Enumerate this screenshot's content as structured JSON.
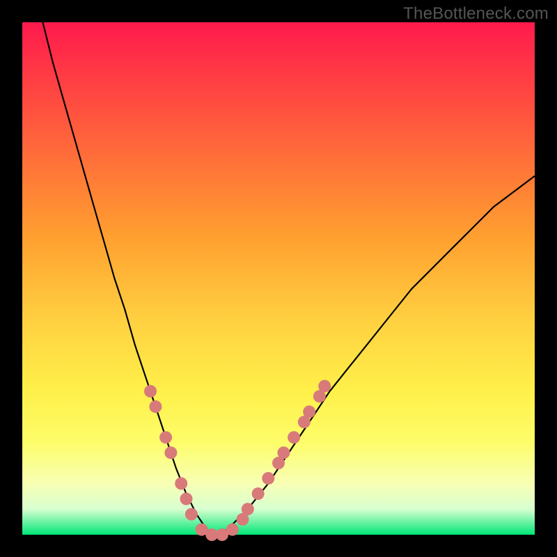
{
  "watermark": {
    "text": "TheBottleneck.com"
  },
  "chart_data": {
    "type": "line",
    "title": "",
    "xlabel": "",
    "ylabel": "",
    "xlim": [
      0,
      100
    ],
    "ylim": [
      0,
      100
    ],
    "grid": false,
    "legend": false,
    "background_gradient": {
      "direction": "vertical",
      "stops": [
        {
          "pos": 0.0,
          "color": "#ff1a4d"
        },
        {
          "pos": 0.1,
          "color": "#ff3a44"
        },
        {
          "pos": 0.25,
          "color": "#ff6a3a"
        },
        {
          "pos": 0.42,
          "color": "#ffa030"
        },
        {
          "pos": 0.58,
          "color": "#ffd040"
        },
        {
          "pos": 0.72,
          "color": "#fff04a"
        },
        {
          "pos": 0.82,
          "color": "#fdfd6a"
        },
        {
          "pos": 0.9,
          "color": "#f8ffb4"
        },
        {
          "pos": 0.95,
          "color": "#d8ffd0"
        },
        {
          "pos": 1.0,
          "color": "#00e676"
        }
      ]
    },
    "series": [
      {
        "name": "bottleneck-curve",
        "color": "#000000",
        "x": [
          4,
          6,
          8,
          10,
          12,
          14,
          16,
          18,
          20,
          22,
          24,
          26,
          28,
          30,
          32,
          34,
          36,
          38,
          40,
          44,
          48,
          52,
          56,
          60,
          64,
          68,
          72,
          76,
          80,
          84,
          88,
          92,
          96,
          100
        ],
        "y": [
          100,
          92,
          85,
          78,
          71,
          64,
          57,
          50,
          44,
          37,
          31,
          25,
          19,
          13,
          8,
          4,
          1,
          0,
          1,
          5,
          10,
          16,
          22,
          28,
          33,
          38,
          43,
          48,
          52,
          56,
          60,
          64,
          67,
          70
        ]
      }
    ],
    "markers": {
      "name": "typical-range-dots",
      "color": "#d87a7a",
      "radius_px": 9,
      "points": [
        {
          "x": 25,
          "y": 28
        },
        {
          "x": 26,
          "y": 25
        },
        {
          "x": 28,
          "y": 19
        },
        {
          "x": 29,
          "y": 16
        },
        {
          "x": 31,
          "y": 10
        },
        {
          "x": 32,
          "y": 7
        },
        {
          "x": 33,
          "y": 4
        },
        {
          "x": 35,
          "y": 1
        },
        {
          "x": 37,
          "y": 0
        },
        {
          "x": 39,
          "y": 0
        },
        {
          "x": 41,
          "y": 1
        },
        {
          "x": 43,
          "y": 3
        },
        {
          "x": 44,
          "y": 5
        },
        {
          "x": 46,
          "y": 8
        },
        {
          "x": 48,
          "y": 11
        },
        {
          "x": 50,
          "y": 14
        },
        {
          "x": 51,
          "y": 16
        },
        {
          "x": 53,
          "y": 19
        },
        {
          "x": 55,
          "y": 22
        },
        {
          "x": 56,
          "y": 24
        },
        {
          "x": 58,
          "y": 27
        },
        {
          "x": 59,
          "y": 29
        }
      ]
    }
  }
}
